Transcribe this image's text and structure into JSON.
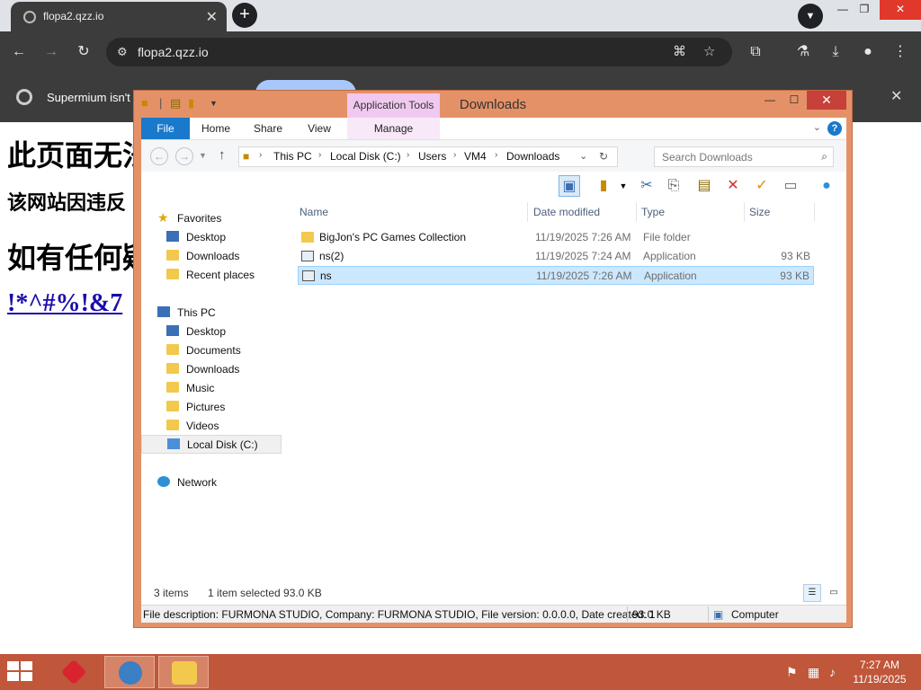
{
  "browser": {
    "tab_title": "flopa2.qzz.io",
    "url": "flopa2.qzz.io",
    "infobar_message": "Supermium isn't"
  },
  "page": {
    "heading1": "此页面无法",
    "heading2": "该网站因违反",
    "heading3": "如有任何疑",
    "link": "!*^#%!&7"
  },
  "explorer": {
    "window_title": "Downloads",
    "context_tab_group": "Application Tools",
    "ribbon_tabs": [
      "File",
      "Home",
      "Share",
      "View",
      "Manage"
    ],
    "breadcrumb": [
      "This PC",
      "Local Disk (C:)",
      "Users",
      "VM4",
      "Downloads"
    ],
    "search_placeholder": "Search Downloads",
    "nav": {
      "favorites_header": "Favorites",
      "favorites": [
        "Desktop",
        "Downloads",
        "Recent places"
      ],
      "thispc_header": "This PC",
      "thispc": [
        "Desktop",
        "Documents",
        "Downloads",
        "Music",
        "Pictures",
        "Videos",
        "Local Disk (C:)"
      ],
      "network": "Network"
    },
    "columns": [
      "Name",
      "Date modified",
      "Type",
      "Size"
    ],
    "files": [
      {
        "name": "BigJon's PC Games Collection",
        "date": "11/19/2025 7:26 AM",
        "type": "File folder",
        "size": "",
        "icon": "folder-icon",
        "selected": false
      },
      {
        "name": "ns(2)",
        "date": "11/19/2025 7:24 AM",
        "type": "Application",
        "size": "93 KB",
        "icon": "application-icon",
        "selected": false
      },
      {
        "name": "ns",
        "date": "11/19/2025 7:26 AM",
        "type": "Application",
        "size": "93 KB",
        "icon": "application-icon",
        "selected": true
      }
    ],
    "status": {
      "item_count": "3 items",
      "selection": "1 item selected  93.0 KB",
      "description": "File description: FURMONA STUDIO, Company: FURMONA STUDIO, File version: 0.0.0.0, Date created: 1",
      "size": "93.0 KB",
      "location": "Computer"
    }
  },
  "taskbar": {
    "time": "7:27 AM",
    "date": "11/19/2025"
  },
  "colors": {
    "window_frame": "#e59168",
    "taskbar": "#c0563a",
    "selection": "#cce8ff",
    "file_tab": "#1979ca"
  }
}
